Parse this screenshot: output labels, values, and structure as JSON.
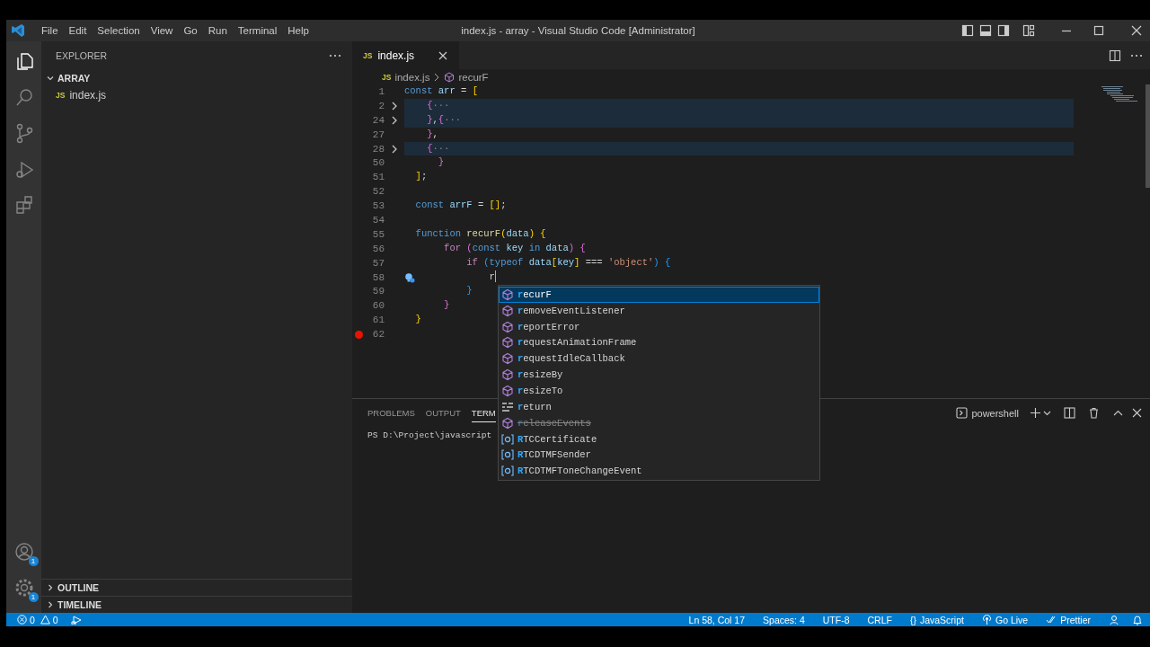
{
  "window": {
    "title": "index.js - array - Visual Studio Code [Administrator]"
  },
  "menu": [
    "File",
    "Edit",
    "Selection",
    "View",
    "Go",
    "Run",
    "Terminal",
    "Help"
  ],
  "activity_bar": [
    {
      "kind": "explorer",
      "selected": true
    },
    {
      "kind": "search",
      "selected": false
    },
    {
      "kind": "scm",
      "selected": false
    },
    {
      "kind": "debug",
      "selected": false
    },
    {
      "kind": "extensions",
      "selected": false
    }
  ],
  "activity_bar_bottom": [
    {
      "kind": "accounts",
      "badge": "1"
    },
    {
      "kind": "settings",
      "badge": "1"
    }
  ],
  "sidebar": {
    "title": "EXPLORER",
    "sections": [
      {
        "title": "ARRAY",
        "expanded": true,
        "items": [
          {
            "icon_text": "JS",
            "name": "index.js"
          }
        ]
      },
      {
        "title": "OUTLINE",
        "expanded": false
      },
      {
        "title": "TIMELINE",
        "expanded": false
      }
    ]
  },
  "editor": {
    "tabs": [
      {
        "icon_text": "JS",
        "label": "index.js",
        "selected": true
      }
    ],
    "breadcrumb": [
      {
        "kind": "file",
        "icon_text": "JS",
        "text": "index.js"
      },
      {
        "kind": "method",
        "text": "recurF"
      }
    ],
    "lines": [
      {
        "number": "1",
        "folded": false,
        "highlighted": false,
        "breakpoint": false,
        "lightbulb": false,
        "tokens": [
          {
            "text": "const ",
            "kind": "keyword"
          },
          {
            "text": "arr",
            "kind": "variable"
          },
          {
            "text": " = ",
            "kind": "punct"
          },
          {
            "text": "[",
            "kind": "bracket1"
          }
        ]
      },
      {
        "number": "2",
        "folded": true,
        "highlighted": true,
        "breakpoint": false,
        "lightbulb": false,
        "tokens": [
          {
            "text": "    {",
            "kind": "bracket2"
          },
          {
            "text": "···",
            "kind": "ellipsis"
          }
        ]
      },
      {
        "number": "24",
        "folded": true,
        "highlighted": true,
        "breakpoint": false,
        "lightbulb": false,
        "tokens": [
          {
            "text": "    }",
            "kind": "bracket2"
          },
          {
            "text": ",",
            "kind": "punct"
          },
          {
            "text": "{",
            "kind": "bracket2"
          },
          {
            "text": "···",
            "kind": "ellipsis"
          }
        ]
      },
      {
        "number": "27",
        "folded": false,
        "highlighted": false,
        "breakpoint": false,
        "lightbulb": false,
        "tokens": [
          {
            "text": "    }",
            "kind": "bracket2"
          },
          {
            "text": ",",
            "kind": "punct"
          }
        ]
      },
      {
        "number": "28",
        "folded": true,
        "highlighted": true,
        "breakpoint": false,
        "lightbulb": false,
        "tokens": [
          {
            "text": "    {",
            "kind": "bracket2"
          },
          {
            "text": "···",
            "kind": "ellipsis"
          }
        ]
      },
      {
        "number": "50",
        "folded": false,
        "highlighted": false,
        "breakpoint": false,
        "lightbulb": false,
        "tokens": [
          {
            "text": "      }",
            "kind": "bracket2"
          }
        ]
      },
      {
        "number": "51",
        "folded": false,
        "highlighted": false,
        "breakpoint": false,
        "lightbulb": false,
        "tokens": [
          {
            "text": "  ]",
            "kind": "bracket1"
          },
          {
            "text": ";",
            "kind": "punct"
          }
        ]
      },
      {
        "number": "52",
        "folded": false,
        "highlighted": false,
        "breakpoint": false,
        "lightbulb": false
      },
      {
        "number": "53",
        "folded": false,
        "highlighted": false,
        "breakpoint": false,
        "lightbulb": false,
        "tokens": [
          {
            "text": "  const ",
            "kind": "keyword"
          },
          {
            "text": "arrF",
            "kind": "variable"
          },
          {
            "text": " = ",
            "kind": "punct"
          },
          {
            "text": "[]",
            "kind": "bracket1"
          },
          {
            "text": ";",
            "kind": "punct"
          }
        ]
      },
      {
        "number": "54",
        "folded": false,
        "highlighted": false,
        "breakpoint": false,
        "lightbulb": false
      },
      {
        "number": "55",
        "folded": false,
        "highlighted": false,
        "breakpoint": false,
        "lightbulb": false,
        "tokens": [
          {
            "text": "  function ",
            "kind": "keyword"
          },
          {
            "text": "recurF",
            "kind": "function"
          },
          {
            "text": "(",
            "kind": "bracket1"
          },
          {
            "text": "data",
            "kind": "variable"
          },
          {
            "text": ") {",
            "kind": "bracket1"
          }
        ]
      },
      {
        "number": "56",
        "folded": false,
        "highlighted": false,
        "breakpoint": false,
        "lightbulb": false,
        "tokens": [
          {
            "text": "       for ",
            "kind": "control"
          },
          {
            "text": "(",
            "kind": "bracket2"
          },
          {
            "text": "const ",
            "kind": "keyword"
          },
          {
            "text": "key ",
            "kind": "variable"
          },
          {
            "text": "in ",
            "kind": "keyword"
          },
          {
            "text": "data",
            "kind": "variable"
          },
          {
            "text": ") {",
            "kind": "bracket2"
          }
        ]
      },
      {
        "number": "57",
        "folded": false,
        "highlighted": false,
        "breakpoint": false,
        "lightbulb": false,
        "tokens": [
          {
            "text": "           if ",
            "kind": "control"
          },
          {
            "text": "(",
            "kind": "bracket3"
          },
          {
            "text": "typeof ",
            "kind": "keyword"
          },
          {
            "text": "data",
            "kind": "variable"
          },
          {
            "text": "[",
            "kind": "bracket1"
          },
          {
            "text": "key",
            "kind": "variable"
          },
          {
            "text": "]",
            "kind": "bracket1"
          },
          {
            "text": " === ",
            "kind": "punct"
          },
          {
            "text": "'object'",
            "kind": "string"
          },
          {
            "text": ") {",
            "kind": "bracket3"
          }
        ]
      },
      {
        "number": "58",
        "folded": false,
        "highlighted": false,
        "breakpoint": false,
        "lightbulb": true,
        "tokens": [
          {
            "text": "               r",
            "kind": "typed"
          }
        ]
      },
      {
        "number": "59",
        "folded": false,
        "highlighted": false,
        "breakpoint": false,
        "lightbulb": false,
        "tokens": [
          {
            "text": "           }",
            "kind": "bracket3"
          }
        ]
      },
      {
        "number": "60",
        "folded": false,
        "highlighted": false,
        "breakpoint": false,
        "lightbulb": false,
        "tokens": [
          {
            "text": "       }",
            "kind": "bracket2"
          }
        ]
      },
      {
        "number": "61",
        "folded": false,
        "highlighted": false,
        "breakpoint": false,
        "lightbulb": false,
        "tokens": [
          {
            "text": "  }",
            "kind": "bracket1"
          }
        ]
      },
      {
        "number": "62",
        "folded": false,
        "highlighted": false,
        "breakpoint": true,
        "lightbulb": false
      }
    ]
  },
  "suggest": {
    "items": [
      {
        "label": "recurF",
        "kind": "method",
        "selected": true,
        "deprecated": false
      },
      {
        "label": "removeEventListener",
        "kind": "method",
        "selected": false,
        "deprecated": false
      },
      {
        "label": "reportError",
        "kind": "method",
        "selected": false,
        "deprecated": false
      },
      {
        "label": "requestAnimationFrame",
        "kind": "method",
        "selected": false,
        "deprecated": false
      },
      {
        "label": "requestIdleCallback",
        "kind": "method",
        "selected": false,
        "deprecated": false
      },
      {
        "label": "resizeBy",
        "kind": "method",
        "selected": false,
        "deprecated": false
      },
      {
        "label": "resizeTo",
        "kind": "method",
        "selected": false,
        "deprecated": false
      },
      {
        "label": "return",
        "kind": "keyword",
        "selected": false,
        "deprecated": false
      },
      {
        "label": "releaseEvents",
        "kind": "method",
        "selected": false,
        "deprecated": true
      },
      {
        "label": "RTCCertificate",
        "kind": "variable",
        "selected": false,
        "deprecated": false
      },
      {
        "label": "RTCDTMFSender",
        "kind": "variable",
        "selected": false,
        "deprecated": false
      },
      {
        "label": "RTCDTMFToneChangeEvent",
        "kind": "variable",
        "selected": false,
        "deprecated": false
      }
    ]
  },
  "panel": {
    "tabs": [
      {
        "label": "PROBLEMS",
        "selected": false
      },
      {
        "label": "OUTPUT",
        "selected": false
      },
      {
        "label": "TERM",
        "selected": true
      }
    ],
    "profile": "powershell",
    "terminal_lines": [
      "PS D:\\Project\\javascript"
    ]
  },
  "status_bar": {
    "errors": "0",
    "warnings": "0",
    "right": [
      {
        "kind": "plain",
        "text": "Ln 58, Col 17"
      },
      {
        "kind": "plain",
        "text": "Spaces: 4"
      },
      {
        "kind": "plain",
        "text": "UTF-8"
      },
      {
        "kind": "plain",
        "text": "CRLF"
      },
      {
        "kind": "language",
        "icon_text": "{}",
        "text": "JavaScript"
      },
      {
        "kind": "live",
        "text": "Go Live"
      },
      {
        "kind": "prettier",
        "text": "Prettier"
      }
    ]
  }
}
